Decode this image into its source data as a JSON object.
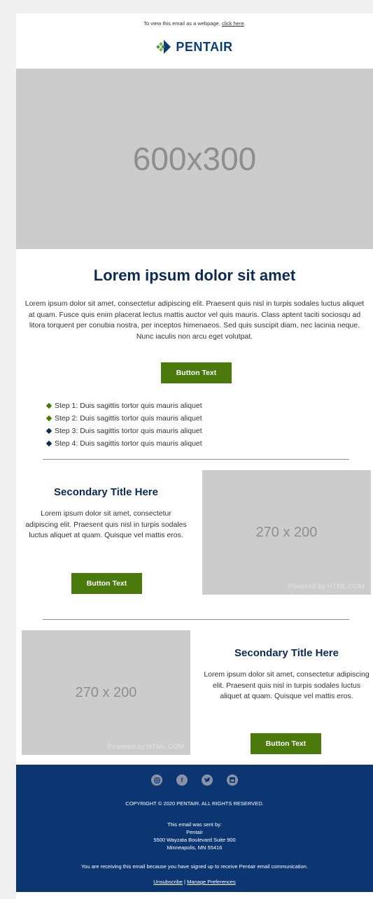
{
  "preheader": {
    "text": "To view this email as a webpage, ",
    "link": "click here",
    "suffix": "."
  },
  "logo": {
    "word": "PENTAIR"
  },
  "hero": {
    "placeholder": "600x300"
  },
  "main": {
    "title": "Lorem ipsum dolor sit amet",
    "body": "Lorem ipsum dolor sit amet, consectetur adipiscing elit. Praesent quis nisl in turpis sodales luctus aliquet at quam. Fusce quis enim placerat lectus mattis auctor vel quis mauris. Class aptent taciti sociosqu ad litora torquent per conubia nostra, per inceptos himenaeos. Sed quis suscipit diam, nec lacinia neque. Nunc iaculis non arcu eget volutpat.",
    "button": "Button Text"
  },
  "steps": [
    {
      "text": "Step 1: Duis sagittis tortor quis mauris aliquet",
      "color": "#4a7a0c"
    },
    {
      "text": "Step 2: Duis sagittis tortor quis mauris aliquet",
      "color": "#4a7a0c"
    },
    {
      "text": "Step 3: Duis sagittis tortor quis mauris aliquet",
      "color": "#0b2a57"
    },
    {
      "text": "Step 4: Duis sagittis tortor quis mauris aliquet",
      "color": "#0b2a57"
    }
  ],
  "section1": {
    "title": "Secondary Title Here",
    "body": "Lorem ipsum dolor sit amet, consectetur adipiscing elit. Praesent quis nisl in turpis sodales luctus aliquet at quam. Quisque vel mattis eros.",
    "button": "Button Text",
    "image": "270 x 200",
    "powered": "Powered by HTML.COM"
  },
  "section2": {
    "title": "Secondary Title Here",
    "body": "Lorem ipsum dolor sit amet, consectetur adipiscing elit. Praesent quis nisl in turpis sodales luctus aliquet at quam. Quisque vel mattis eros.",
    "button": "Button Text",
    "image": "270 x 200",
    "powered": "Powered by HTML.COM"
  },
  "footer": {
    "socials": [
      "instagram-icon",
      "facebook-icon",
      "twitter-icon",
      "linkedin-icon"
    ],
    "copyright": "COPYRIGHT © 2020 PENTAIR. ALL RIGHTS RESERVED.",
    "sent_by": "This email was sent by:",
    "company": "Pentair",
    "address1": "5500 Wayzata Boulevard Suite 900",
    "address2": "Minneapolis, MN 55416",
    "notice": "You are receiving this email because you have signed up to receive Pentair email communication.",
    "unsubscribe": "Unsubscribe",
    "separator": " | ",
    "manage": "Manage Preferences"
  },
  "colors": {
    "brand_green": "#4a7a0c",
    "brand_navy": "#0b2a57",
    "footer_bg": "#0c3671"
  }
}
